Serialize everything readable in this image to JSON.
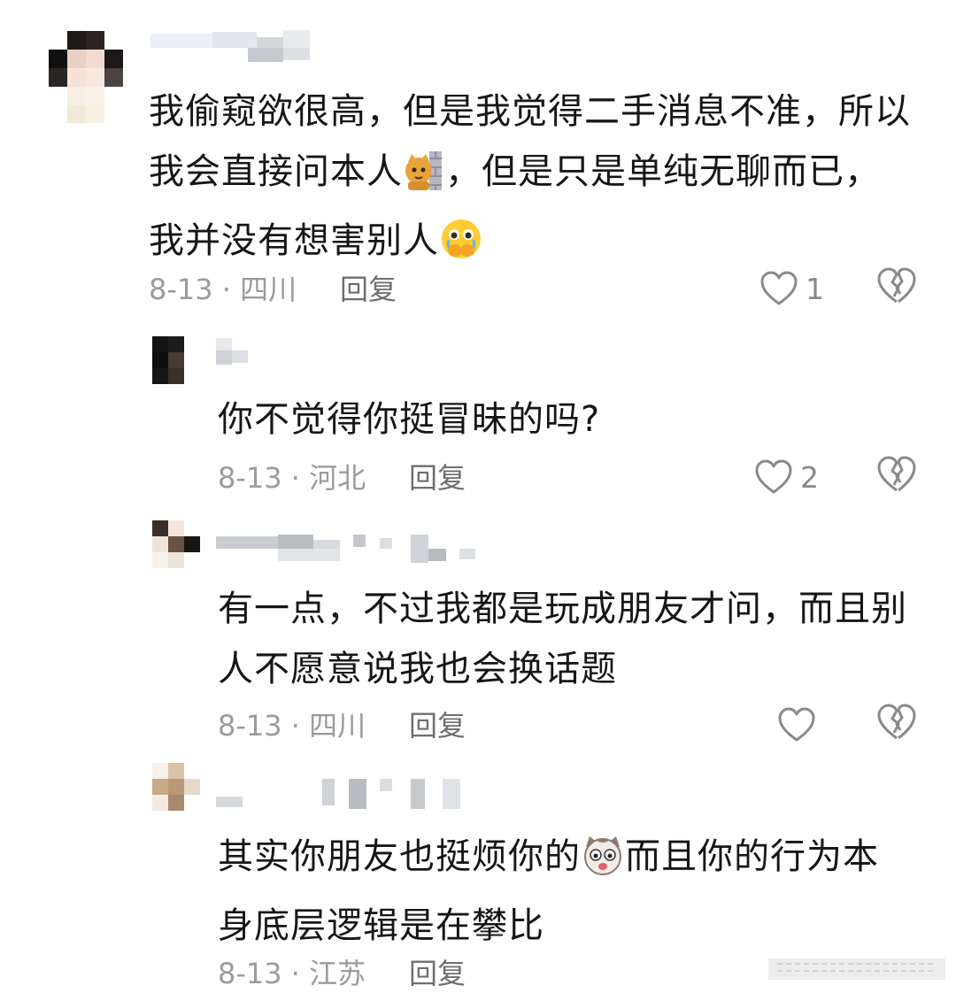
{
  "comments": [
    {
      "text_lines": [
        "我偷窥欲很高，但是我觉得二手消息不准，所以",
        "我会直接问本人",
        "，但是只是单纯无聊而已，",
        "我并没有想害别人"
      ],
      "date_location": "8-13 · 四川",
      "reply_label": "回复",
      "like_count": "1"
    },
    {
      "text_lines": [
        "你不觉得你挺冒昧的吗?"
      ],
      "date_location": "8-13 · 河北",
      "reply_label": "回复",
      "like_count": "2"
    },
    {
      "text_lines": [
        "有一点，不过我都是玩成朋友才问，而且别",
        "人不愿意说我也会换话题"
      ],
      "date_location": "8-13 · 四川",
      "reply_label": "回复",
      "like_count": ""
    },
    {
      "text_lines": [
        "其实你朋友也挺烦你的",
        "而且你的行为本",
        "身底层逻辑是在攀比"
      ],
      "date_location": "8-13 · 江苏",
      "reply_label": "回复",
      "like_count": ""
    }
  ],
  "colors": {
    "text": "#161616",
    "meta": "#9b9b9b",
    "reply": "#6e6e6e",
    "icon": "#8a8a8a"
  },
  "icons": {
    "like": "heart-outline-icon",
    "dislike": "broken-heart-icon",
    "emoji_1": "cat-behind-wall-emoji",
    "emoji_2": "crying-hands-over-mouth-emoji",
    "emoji_3": "shocked-cat-emoji"
  }
}
